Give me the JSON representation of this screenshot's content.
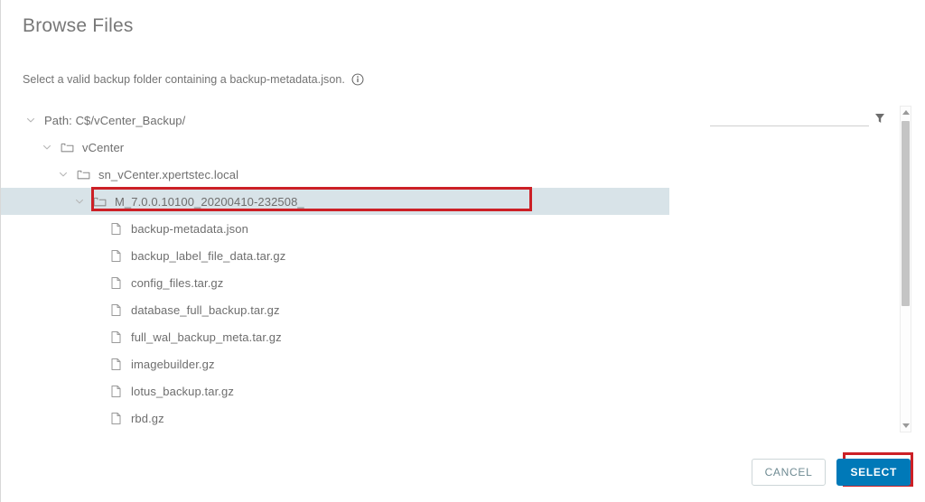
{
  "dialog": {
    "title": "Browse Files",
    "subtitle": "Select a valid backup folder containing a backup-metadata.json.",
    "info_icon": "info-circle-icon"
  },
  "filter": {
    "value": "",
    "placeholder": "",
    "icon": "funnel-filter-icon"
  },
  "scrollbar": {
    "up_icon": "scroll-up-arrow-icon",
    "down_icon": "scroll-down-arrow-icon"
  },
  "tree": {
    "nodes": [
      {
        "label": "Path: C$/vCenter_Backup/",
        "type": "path",
        "indent": 0,
        "expanded": true,
        "selected": false
      },
      {
        "label": "vCenter",
        "type": "folder",
        "indent": 1,
        "expanded": true,
        "selected": false
      },
      {
        "label": "sn_vCenter.xpertstec.local",
        "type": "folder",
        "indent": 2,
        "expanded": true,
        "selected": false
      },
      {
        "label": "M_7.0.0.10100_20200410-232508_",
        "type": "folder",
        "indent": 3,
        "expanded": true,
        "selected": true
      },
      {
        "label": "backup-metadata.json",
        "type": "file",
        "indent": 4,
        "expanded": false,
        "selected": false
      },
      {
        "label": "backup_label_file_data.tar.gz",
        "type": "file",
        "indent": 4,
        "expanded": false,
        "selected": false
      },
      {
        "label": "config_files.tar.gz",
        "type": "file",
        "indent": 4,
        "expanded": false,
        "selected": false
      },
      {
        "label": "database_full_backup.tar.gz",
        "type": "file",
        "indent": 4,
        "expanded": false,
        "selected": false
      },
      {
        "label": "full_wal_backup_meta.tar.gz",
        "type": "file",
        "indent": 4,
        "expanded": false,
        "selected": false
      },
      {
        "label": "imagebuilder.gz",
        "type": "file",
        "indent": 4,
        "expanded": false,
        "selected": false
      },
      {
        "label": "lotus_backup.tar.gz",
        "type": "file",
        "indent": 4,
        "expanded": false,
        "selected": false
      },
      {
        "label": "rbd.gz",
        "type": "file",
        "indent": 4,
        "expanded": false,
        "selected": false
      }
    ]
  },
  "footer": {
    "cancel_label": "CANCEL",
    "select_label": "SELECT"
  },
  "colors": {
    "primary_button": "#0079b8",
    "annotation": "#cc2026",
    "selection": "#d8e3e8",
    "text": "#6e6e6e",
    "cancel_text": "#6f8b93"
  }
}
